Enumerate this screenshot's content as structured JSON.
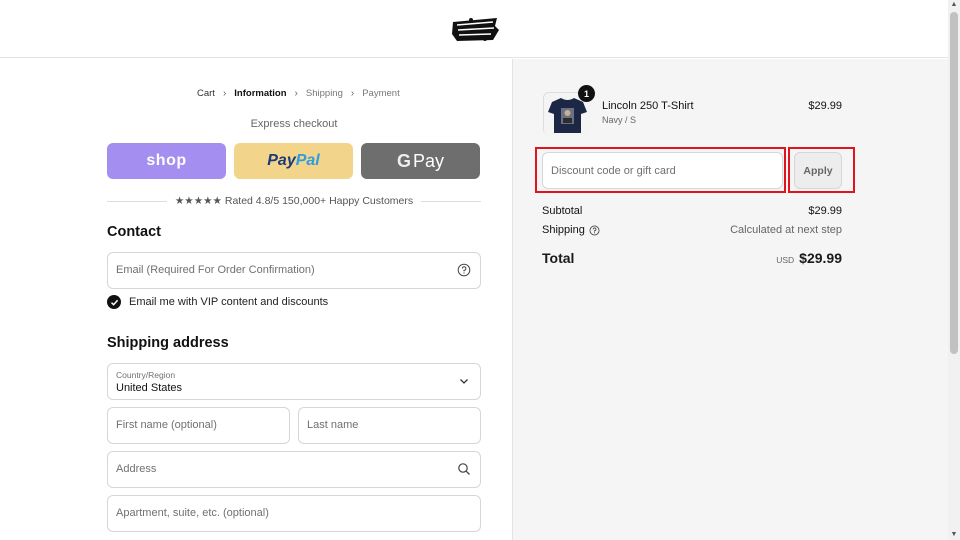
{
  "brand": {
    "logo_icon": "rhythm-beat-logo"
  },
  "breadcrumb": {
    "items": [
      {
        "label": "Cart"
      },
      {
        "label": "Information"
      },
      {
        "label": "Shipping"
      },
      {
        "label": "Payment"
      }
    ],
    "separator": "›"
  },
  "express": {
    "title": "Express checkout",
    "shop_label": "shop",
    "paypal_part1": "Pay",
    "paypal_part2": "Pal",
    "gpay_g": "G",
    "gpay_label": "Pay"
  },
  "rating": {
    "text": "★★★★★ Rated 4.8/5 150,000+ Happy Customers"
  },
  "contact": {
    "title": "Contact",
    "email_placeholder": "Email (Required For Order Confirmation)",
    "vip_label": "Email me with VIP content and discounts"
  },
  "shipping": {
    "title": "Shipping address",
    "country_label": "Country/Region",
    "country_value": "United States",
    "first_name_placeholder": "First name (optional)",
    "last_name_placeholder": "Last name",
    "address_placeholder": "Address",
    "apartment_placeholder": "Apartment, suite, etc. (optional)"
  },
  "order": {
    "item": {
      "name": "Lincoln 250 T-Shirt",
      "variant": "Navy / S",
      "price": "$29.99",
      "quantity": "1"
    },
    "discount_placeholder": "Discount code or gift card",
    "apply_label": "Apply",
    "subtotal_label": "Subtotal",
    "subtotal_value": "$29.99",
    "shipping_label": "Shipping",
    "shipping_value": "Calculated at next step",
    "total_label": "Total",
    "total_currency": "USD",
    "total_value": "$29.99"
  },
  "colors": {
    "shop": "#a48ff1",
    "paypal": "#f2d58a",
    "gpay": "#6e6e6e",
    "highlight": "#e0141e"
  }
}
